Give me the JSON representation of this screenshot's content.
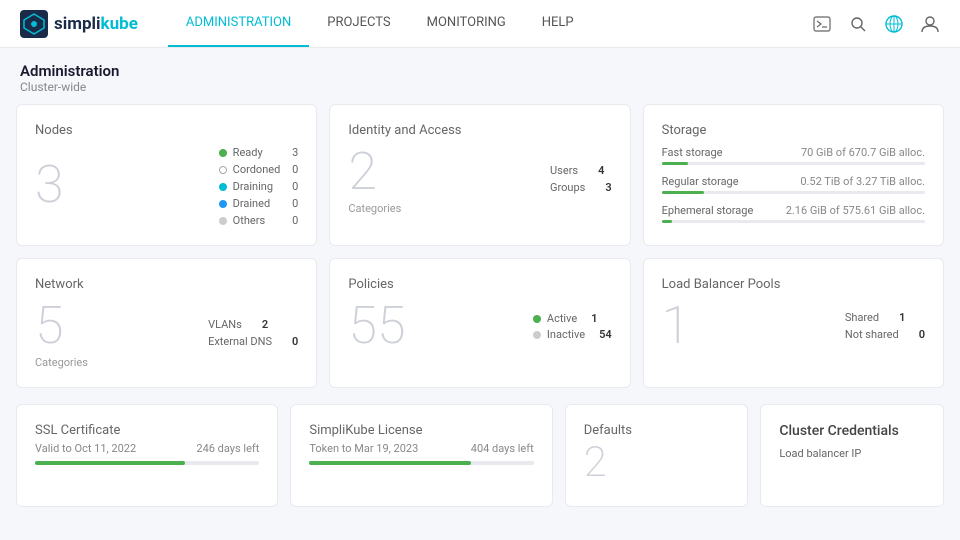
{
  "app": {
    "logo_simpli": "simpli",
    "logo_kube": "kube"
  },
  "nav": {
    "items": [
      {
        "label": "ADMINISTRATION",
        "active": true
      },
      {
        "label": "PROJECTS",
        "active": false
      },
      {
        "label": "MONITORING",
        "active": false
      },
      {
        "label": "HELP",
        "active": false
      }
    ]
  },
  "breadcrumb": {
    "title": "Administration",
    "subtitle": "Cluster-wide"
  },
  "cards": {
    "nodes": {
      "title": "Nodes",
      "count": "3",
      "legend": [
        {
          "label": "Ready",
          "count": "3",
          "color": "#4caf50",
          "type": "dot"
        },
        {
          "label": "Cordoned",
          "count": "0",
          "color": "#ccc",
          "type": "outline-gray"
        },
        {
          "label": "Draining",
          "count": "0",
          "color": "#00bcd4",
          "type": "dot"
        },
        {
          "label": "Drained",
          "count": "0",
          "color": "#2196f3",
          "type": "dot"
        },
        {
          "label": "Others",
          "count": "0",
          "color": "#ccc",
          "type": "dot"
        }
      ]
    },
    "identity": {
      "title": "Identity and Access",
      "count": "2",
      "subtitle": "Categories",
      "stats": [
        {
          "label": "Users",
          "value": "4"
        },
        {
          "label": "Groups",
          "value": "3"
        }
      ]
    },
    "storage": {
      "title": "Storage",
      "rows": [
        {
          "label": "Fast storage",
          "value": "70 GiB of 670.7 GiB alloc.",
          "pct": 10,
          "color": "#4caf50"
        },
        {
          "label": "Regular storage",
          "value": "0.52 TiB of 3.27 TiB alloc.",
          "pct": 16,
          "color": "#4caf50"
        },
        {
          "label": "Ephemeral storage",
          "value": "2.16 GiB of 575.61 GiB alloc.",
          "pct": 4,
          "color": "#4caf50"
        }
      ]
    },
    "network": {
      "title": "Network",
      "count": "5",
      "subtitle": "Categories",
      "stats": [
        {
          "label": "VLANs",
          "value": "2"
        },
        {
          "label": "External DNS",
          "value": "0"
        }
      ]
    },
    "policies": {
      "title": "Policies",
      "count": "55",
      "stats": [
        {
          "label": "Active",
          "value": "1",
          "color": "#4caf50"
        },
        {
          "label": "Inactive",
          "value": "54",
          "color": "#ccc"
        }
      ]
    },
    "lb": {
      "title": "Load Balancer Pools",
      "count": "1",
      "stats": [
        {
          "label": "Shared",
          "value": "1"
        },
        {
          "label": "Not shared",
          "value": "0"
        }
      ]
    }
  },
  "bottom": {
    "ssl": {
      "title": "SSL Certificate",
      "valid_label": "Valid to Oct 11, 2022",
      "days_label": "246 days left",
      "bar_pct": 67,
      "bar_color": "#4caf50"
    },
    "license": {
      "title": "SimpliKube License",
      "valid_label": "Token to Mar 19, 2023",
      "days_label": "404 days left",
      "bar_pct": 72,
      "bar_color": "#4caf50"
    },
    "defaults": {
      "title": "Defaults",
      "count": "2"
    },
    "cluster": {
      "title": "Cluster Credentials",
      "item": "Load balancer IP"
    }
  }
}
